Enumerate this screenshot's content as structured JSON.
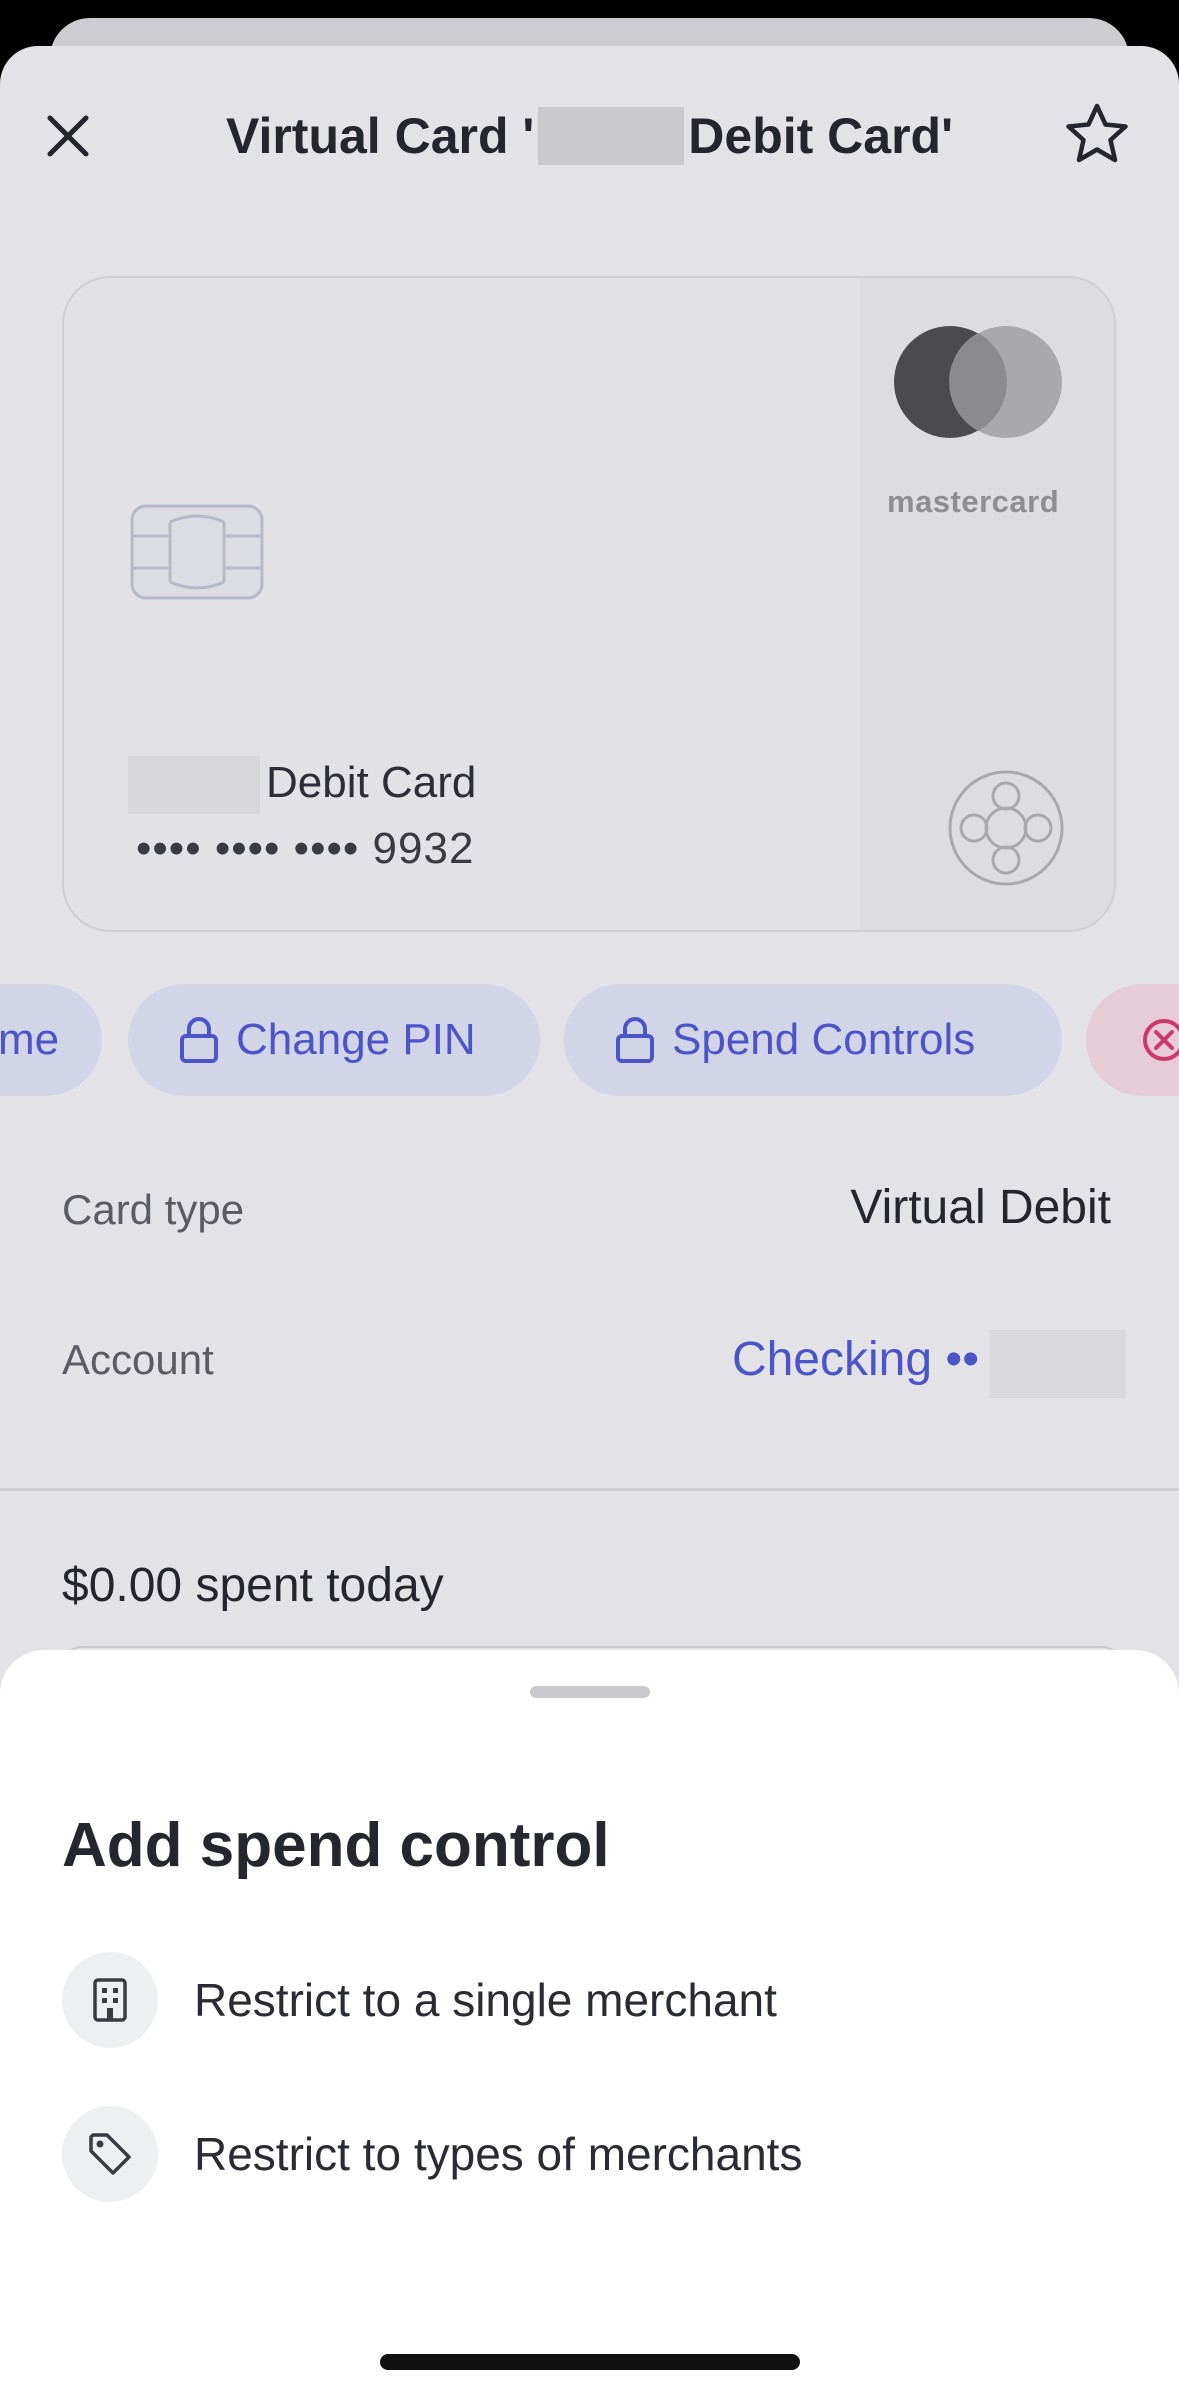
{
  "header": {
    "title_prefix": "Virtual Card '",
    "title_suffix": "Debit Card'"
  },
  "card": {
    "network_label": "mastercard",
    "name_label": "Debit Card",
    "number_masked": "•••• •••• •••• 9932"
  },
  "actions": [
    {
      "label": "me"
    },
    {
      "label": "Change PIN"
    },
    {
      "label": "Spend Controls"
    }
  ],
  "details": {
    "card_type_label": "Card type",
    "card_type_value": "Virtual Debit",
    "account_label": "Account",
    "account_value": "Checking ••"
  },
  "spend": {
    "today_text": "$0.00 spent today"
  },
  "sheet": {
    "title": "Add spend control",
    "options": [
      {
        "label": "Restrict to a single merchant",
        "icon": "building-icon"
      },
      {
        "label": "Restrict to types of merchants",
        "icon": "tag-icon"
      }
    ]
  },
  "colors": {
    "accent": "#4b55c8",
    "danger": "#d0366a",
    "sheet_bg": "#e3e3e7"
  }
}
